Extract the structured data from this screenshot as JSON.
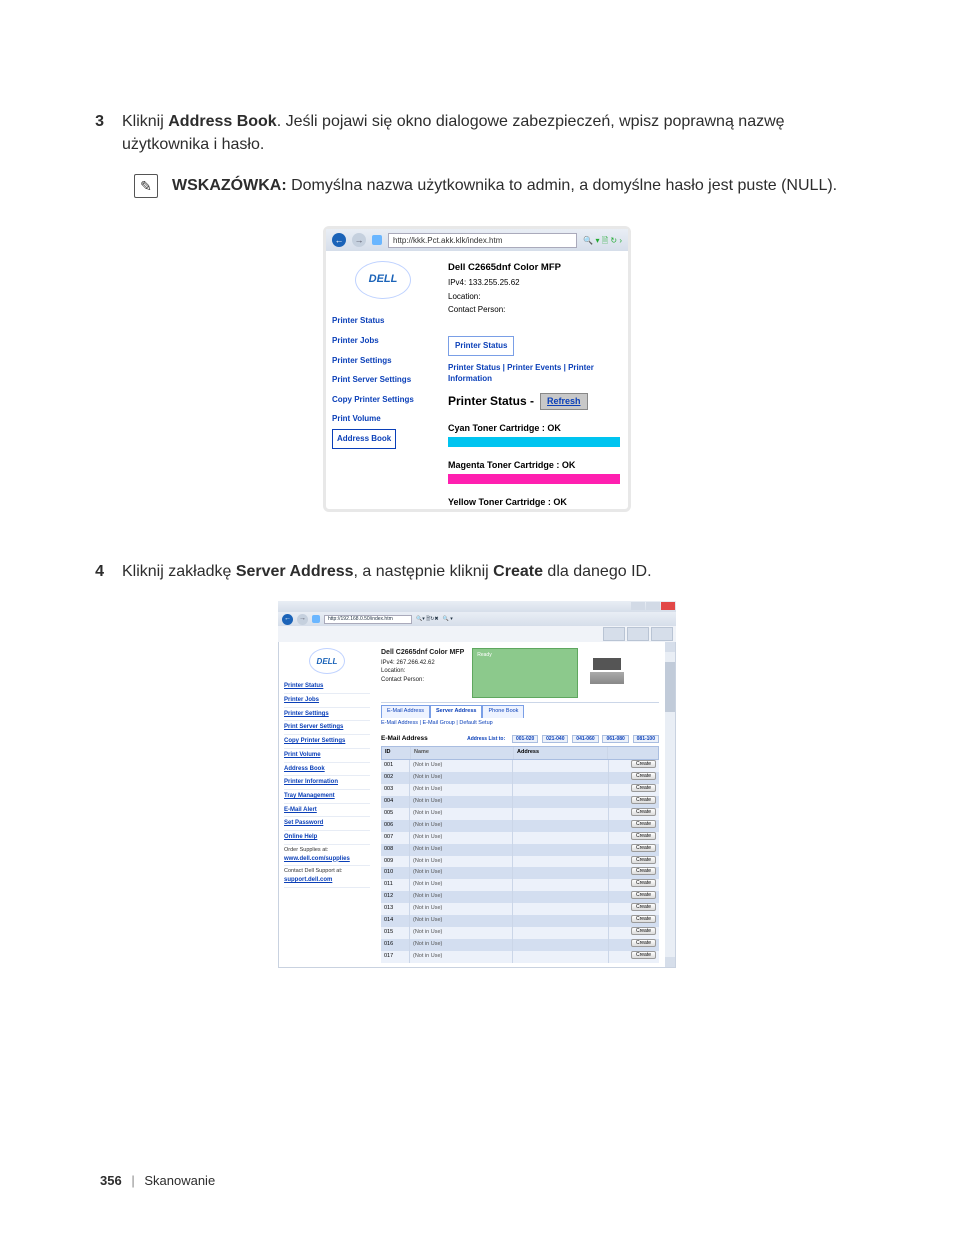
{
  "steps": {
    "s3": {
      "num": "3",
      "pre": "Kliknij ",
      "bold": "Address Book",
      "post": ". Jeśli pojawi się okno dialogowe zabezpieczeń, wpisz poprawną nazwę użytkownika i hasło."
    },
    "tip": {
      "label": "WSKAZÓWKA:",
      "text": " Domyślna nazwa użytkownika to admin, a domyślne hasło jest puste (NULL)."
    },
    "s4": {
      "num": "4",
      "pre": "Kliknij zakładkę ",
      "bold1": "Server Address",
      "mid": ", a następnie kliknij ",
      "bold2": "Create",
      "post": " dla danego ID."
    }
  },
  "shot1": {
    "url": "http://kkk.Pct.akk.klk/index.htm",
    "logo": "DELL",
    "nav": [
      "Printer Status",
      "Printer Jobs",
      "Printer Settings",
      "Print Server Settings",
      "Copy Printer Settings",
      "Print Volume",
      "Address Book"
    ],
    "title": "Dell C2665dnf Color MFP",
    "ipv4": "IPv4: 133.255.25.62",
    "loc": "Location:",
    "contact": "Contact Person:",
    "tab": "Printer Status",
    "crumbs": "Printer Status | Printer Events | Printer Information",
    "h2": "Printer Status - ",
    "refresh": "Refresh",
    "cy": "Cyan Toner Cartridge : OK",
    "mg": "Magenta Toner Cartridge : OK",
    "yl": "Yellow Toner Cartridge : OK"
  },
  "shot2": {
    "url": "http://192.168.0.50/index.htm",
    "logo": "DELL",
    "title": "Dell C2665dnf Color MFP",
    "ipv4": "IPv4: 267.266.42.62",
    "loc": "Location:",
    "contact": "Contact Person:",
    "ready": "Ready",
    "nav": [
      "Printer Status",
      "Printer Jobs",
      "Printer Settings",
      "Print Server Settings",
      "Copy Printer Settings",
      "Print Volume",
      "Address Book",
      "Printer Information",
      "Tray Management",
      "E-Mail Alert",
      "Set Password",
      "Online Help"
    ],
    "extra1_label": "Order Supplies at:",
    "extra1_link": "www.dell.com/supplies",
    "extra2_label": "Contact Dell Support at:",
    "extra2_link": "support.dell.com",
    "tabs": [
      "E-Mail Address",
      "Server Address",
      "Phone Book"
    ],
    "sublinks": "E-Mail Address | E-Mail Group | Default Setup",
    "tbl_title": "E-Mail Address",
    "listto_label": "Address List to:",
    "pagers": [
      "001-020",
      "021-040",
      "041-060",
      "061-080",
      "081-100"
    ],
    "cols": {
      "id": "ID",
      "name": "Name",
      "addr": "Address"
    },
    "rows": [
      {
        "id": "001",
        "name": "(Not in Use)"
      },
      {
        "id": "002",
        "name": "(Not in Use)"
      },
      {
        "id": "003",
        "name": "(Not in Use)"
      },
      {
        "id": "004",
        "name": "(Not in Use)"
      },
      {
        "id": "005",
        "name": "(Not in Use)"
      },
      {
        "id": "006",
        "name": "(Not in Use)"
      },
      {
        "id": "007",
        "name": "(Not in Use)"
      },
      {
        "id": "008",
        "name": "(Not in Use)"
      },
      {
        "id": "009",
        "name": "(Not in Use)"
      },
      {
        "id": "010",
        "name": "(Not in Use)"
      },
      {
        "id": "011",
        "name": "(Not in Use)"
      },
      {
        "id": "012",
        "name": "(Not in Use)"
      },
      {
        "id": "013",
        "name": "(Not in Use)"
      },
      {
        "id": "014",
        "name": "(Not in Use)"
      },
      {
        "id": "015",
        "name": "(Not in Use)"
      },
      {
        "id": "016",
        "name": "(Not in Use)"
      },
      {
        "id": "017",
        "name": "(Not in Use)"
      }
    ],
    "create": "Create"
  },
  "footer": {
    "page": "356",
    "sep": "|",
    "section": "Skanowanie"
  }
}
